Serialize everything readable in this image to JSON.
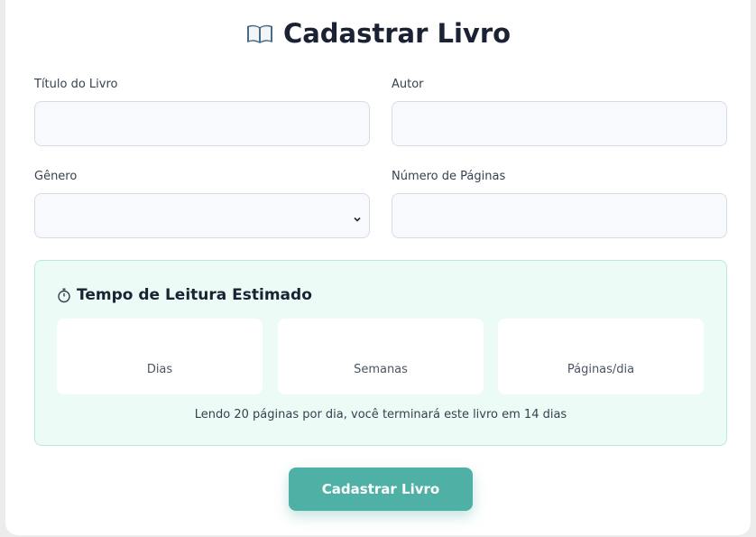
{
  "page": {
    "title": "Cadastrar Livro",
    "title_icon": "open-book-icon"
  },
  "form": {
    "title_label": "Título do Livro",
    "title_value": "",
    "author_label": "Autor",
    "author_value": "",
    "genre_label": "Gênero",
    "genre_selected": "",
    "pages_label": "Número de Páginas",
    "pages_value": ""
  },
  "estimate": {
    "title": "Tempo de Leitura Estimado",
    "title_icon": "stopwatch-icon",
    "stats": [
      {
        "label": "Dias",
        "value": ""
      },
      {
        "label": "Semanas",
        "value": ""
      },
      {
        "label": "Páginas/dia",
        "value": ""
      }
    ],
    "note": "Lendo 20 páginas por dia, você terminará este livro em 14 dias"
  },
  "actions": {
    "submit_label": "Cadastrar Livro"
  },
  "colors": {
    "accent": "#4fb0a6",
    "estimate_bg": "#ecfbf5",
    "estimate_border": "#b8ecd6",
    "input_bg": "#f7f9fc",
    "input_border": "#d7dde6"
  }
}
